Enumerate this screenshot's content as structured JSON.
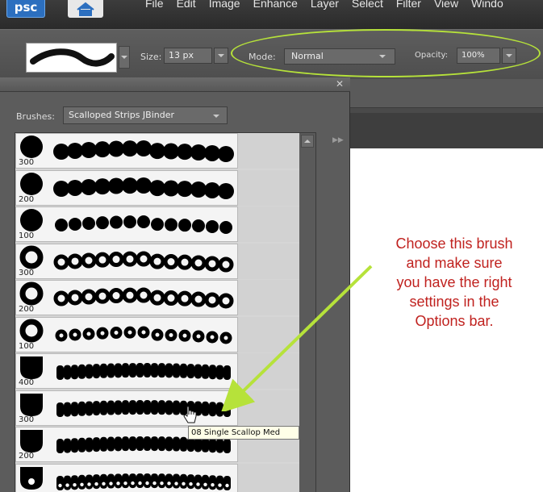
{
  "menubar": {
    "logo": "psc",
    "items": [
      "File",
      "Edit",
      "Image",
      "Enhance",
      "Layer",
      "Select",
      "Filter",
      "View",
      "Windo"
    ]
  },
  "options": {
    "size_label": "Size:",
    "size_value": "13 px",
    "mode_label": "Mode:",
    "mode_value": "Normal",
    "opacity_label": "Opacity:",
    "opacity_value": "100%"
  },
  "panel": {
    "brushes_label": "Brushes:",
    "brushes_value": "Scalloped Strips JBinder",
    "rows": [
      {
        "size": "300",
        "kind": "dot-solid"
      },
      {
        "size": "200",
        "kind": "dot-solid"
      },
      {
        "size": "100",
        "kind": "dot-solid"
      },
      {
        "size": "300",
        "kind": "ring"
      },
      {
        "size": "200",
        "kind": "ring"
      },
      {
        "size": "100",
        "kind": "ring"
      },
      {
        "size": "400",
        "kind": "scallop"
      },
      {
        "size": "300",
        "kind": "scallop"
      },
      {
        "size": "200",
        "kind": "scallop"
      },
      {
        "size": "",
        "kind": "scallop-dots"
      }
    ]
  },
  "tooltip": "08 Single Scallop Med",
  "annotation": {
    "lines": [
      "Choose this brush",
      "and make sure",
      "you have the right",
      "settings in the",
      "Options bar."
    ]
  },
  "colors": {
    "annotation": "#c0221f",
    "highlight": "#b6e23a"
  }
}
